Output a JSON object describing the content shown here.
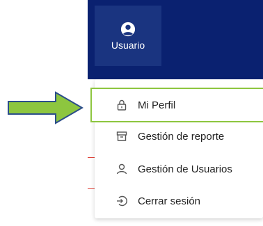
{
  "navbar": {
    "background": "#0a2170",
    "user_tab": {
      "label": "Usuario",
      "icon": "user-circle-icon"
    }
  },
  "dropdown": {
    "items": [
      {
        "label": "Mi Perfil",
        "icon": "lock-icon",
        "highlighted": true
      },
      {
        "label": "Gestión de reporte",
        "icon": "archive-icon",
        "highlighted": false
      },
      {
        "label": "Gestión de Usuarios",
        "icon": "user-icon",
        "highlighted": false
      },
      {
        "label": "Cerrar sesión",
        "icon": "logout-icon",
        "highlighted": false
      }
    ]
  },
  "annotation": {
    "arrow_color": "#8dc63f",
    "arrow_border": "#2b4d8a",
    "highlight_color": "#8dc63f"
  }
}
